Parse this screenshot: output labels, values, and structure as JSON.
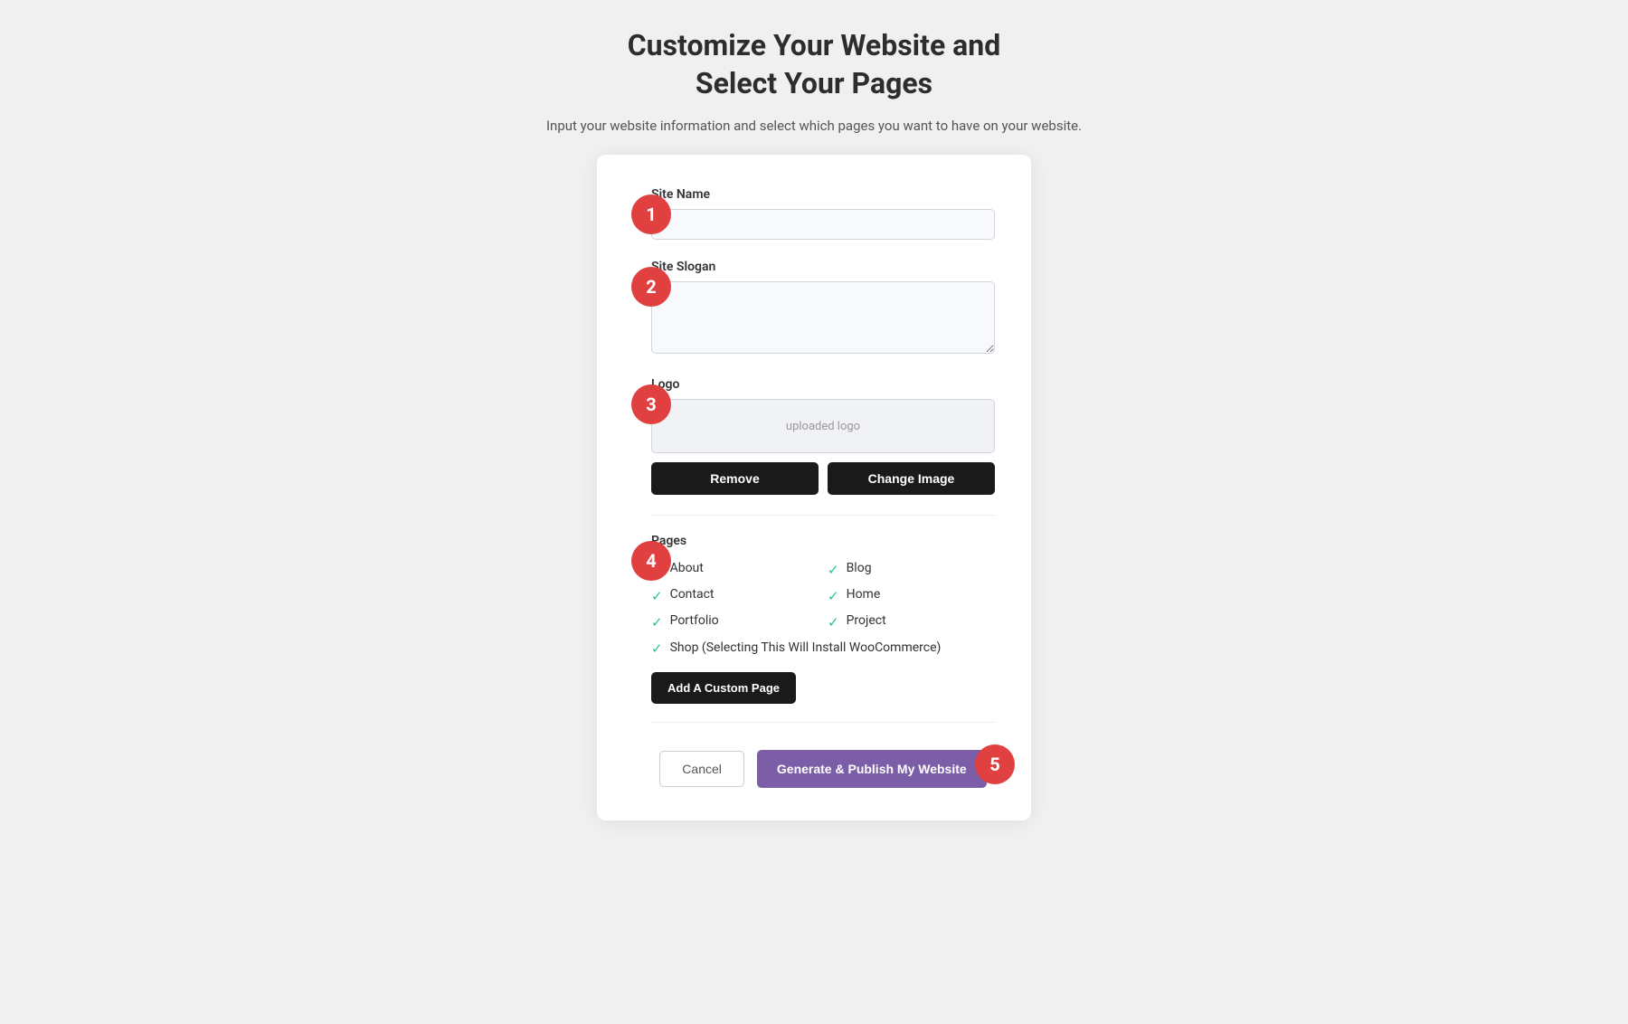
{
  "header": {
    "title_line1": "Customize Your Website and",
    "title_line2": "Select Your Pages",
    "subtitle": "Input your website information and select which pages you want to have on your website."
  },
  "form": {
    "site_name_label": "Site Name",
    "site_name_placeholder": "",
    "site_slogan_label": "Site Slogan",
    "site_slogan_placeholder": "",
    "logo_label": "Logo",
    "logo_placeholder": "uploaded logo",
    "remove_button": "Remove",
    "change_image_button": "Change Image",
    "pages_label": "Pages",
    "pages": [
      {
        "name": "About",
        "checked": true,
        "col": 1
      },
      {
        "name": "Blog",
        "checked": true,
        "col": 2
      },
      {
        "name": "Contact",
        "checked": true,
        "col": 1
      },
      {
        "name": "Home",
        "checked": true,
        "col": 2
      },
      {
        "name": "Portfolio",
        "checked": true,
        "col": 1
      },
      {
        "name": "Project",
        "checked": true,
        "col": 2
      }
    ],
    "shop_page_name": "Shop (Selecting This Will Install WooCommerce)",
    "shop_checked": true,
    "add_custom_page_button": "Add A Custom Page",
    "cancel_button": "Cancel",
    "generate_button": "Generate & Publish My Website"
  },
  "steps": {
    "step1_label": "1",
    "step2_label": "2",
    "step3_label": "3",
    "step4_label": "4",
    "step5_label": "5"
  },
  "icons": {
    "check": "✓"
  }
}
